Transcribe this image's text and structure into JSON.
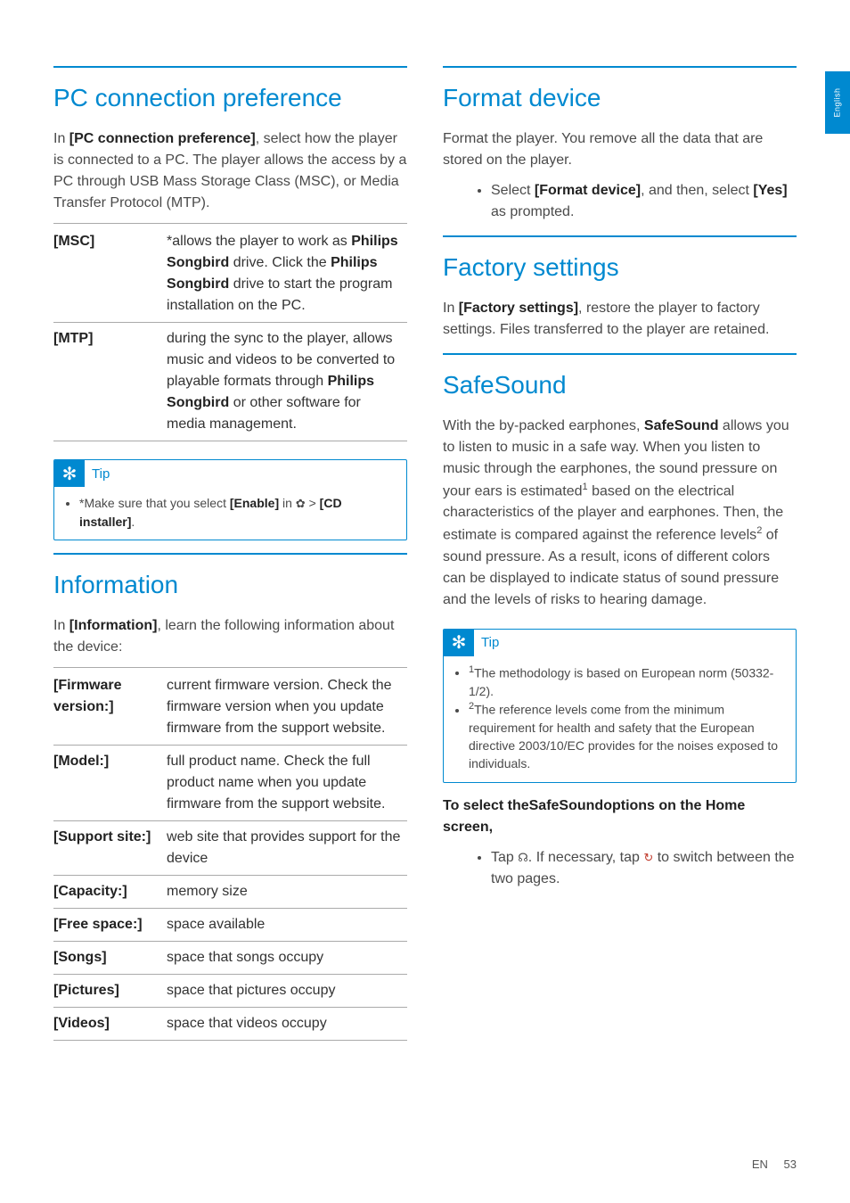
{
  "sideTab": "English",
  "footer": {
    "lang": "EN",
    "page": "53"
  },
  "left": {
    "pc": {
      "heading": "PC connection preference",
      "intro_pre": "In ",
      "intro_bold": "[PC connection preference]",
      "intro_post": ", select how the player is connected to a PC. The player allows the access by a PC through USB Mass Storage Class (MSC), or Media Transfer Protocol (MTP).",
      "rows": {
        "msc": {
          "label": "[MSC]",
          "t1": "*allows the player to work as ",
          "b1": "Philips Songbird",
          "t2": " drive. Click the ",
          "b2": "Philips Songbird",
          "t3": " drive to start the program installation on the PC."
        },
        "mtp": {
          "label": "[MTP]",
          "t1": "during the sync to the player, allows music and videos to be converted to playable formats through ",
          "b1": "Philips Songbird",
          "t2": " or other software for media management."
        }
      },
      "tipLabel": "Tip",
      "tip_t1": "*Make sure that you select ",
      "tip_b1": "[Enable]",
      "tip_t2": " in ",
      "tip_icon": "✿",
      "tip_t3": " > ",
      "tip_b2": "[CD installer]",
      "tip_t4": "."
    },
    "info": {
      "heading": "Information",
      "intro_pre": "In ",
      "intro_bold": "[Information]",
      "intro_post": ", learn the following information about the device:",
      "rows": [
        {
          "label": "[Firmware version:]",
          "desc": "current firmware version. Check the firmware version when you update firmware from the support website."
        },
        {
          "label": "[Model:]",
          "desc": "full product name. Check the full product name when you update firmware from the support website."
        },
        {
          "label": "[Support site:]",
          "desc": "web site that provides support for the device"
        },
        {
          "label": "[Capacity:]",
          "desc": "memory size"
        },
        {
          "label": "[Free space:]",
          "desc": "space available"
        },
        {
          "label": "[Songs]",
          "desc": "space that songs occupy"
        },
        {
          "label": "[Pictures]",
          "desc": "space that pictures occupy"
        },
        {
          "label": "[Videos]",
          "desc": "space that videos occupy"
        }
      ]
    }
  },
  "right": {
    "format": {
      "heading": "Format device",
      "intro": "Format the player. You remove all the data that are stored on the player.",
      "bullet_t1": "Select ",
      "bullet_b1": "[Format device]",
      "bullet_t2": ", and then, select ",
      "bullet_b2": "[Yes]",
      "bullet_t3": " as prompted."
    },
    "factory": {
      "heading": "Factory settings",
      "intro_pre": "In ",
      "intro_bold": "[Factory settings]",
      "intro_post": ", restore the player to factory settings. Files transferred to the player are retained."
    },
    "safe": {
      "heading": "SafeSound",
      "p_t1": "With the by-packed earphones, ",
      "p_b1": "SafeSound",
      "p_t2": " allows you to listen to music in a safe way. When you listen to music through the earphones, the sound pressure on your ears is estimated",
      "p_sup1": "1",
      "p_t3": " based on the electrical characteristics of the player and earphones. Then, the estimate is compared against the reference levels",
      "p_sup2": "2",
      "p_t4": " of sound pressure. As a result, icons of different colors can be displayed to indicate status of sound pressure and the levels of risks to hearing damage.",
      "tipLabel": "Tip",
      "tip1_sup": "1",
      "tip1": "The methodology is based on European norm (50332-1/2).",
      "tip2_sup": "2",
      "tip2": "The reference levels come from the minimum requirement for health and safety that the European directive 2003/10/EC provides for the noises exposed to individuals.",
      "sub_pre": "To select the",
      "sub_bold": "SafeSound",
      "sub_post": "options on the Home screen,",
      "bullet_t1": "Tap ",
      "bullet_icon1": "☊",
      "bullet_t2": ". If necessary, tap ",
      "bullet_icon2": "↻",
      "bullet_t3": " to switch between the two pages."
    }
  }
}
